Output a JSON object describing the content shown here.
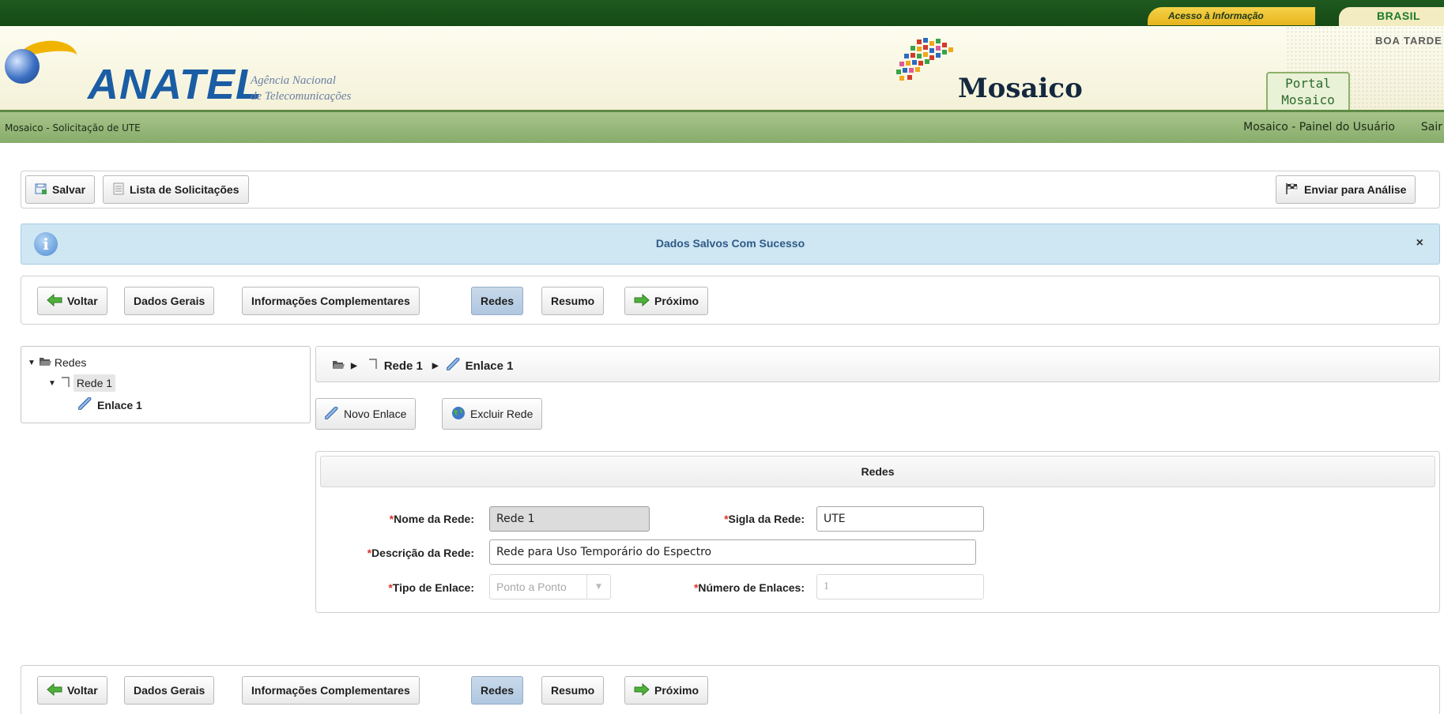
{
  "topbar": {
    "access_label": "Acesso à Informação",
    "country_label": "BRASIL"
  },
  "header": {
    "logo_text": "ANATEL",
    "agency_line1": "Agência Nacional",
    "agency_line2": "de Telecomunicações",
    "product_title": "Mosaico",
    "greeting": "BOA TARDE",
    "portal_tab_line1": "Portal",
    "portal_tab_line2": "Mosaico"
  },
  "nav": {
    "breadcrumb": "Mosaico - Solicitação de UTE",
    "user_panel_link": "Mosaico - Painel do Usuário",
    "exit_link": "Sair"
  },
  "toolbar": {
    "save_label": "Salvar",
    "list_label": "Lista de Solicitações",
    "submit_label": "Enviar para Análise"
  },
  "message": {
    "text": "Dados Salvos Com Sucesso",
    "close": "×"
  },
  "steps": [
    "Voltar",
    "Dados Gerais",
    "Informações Complementares",
    "Redes",
    "Resumo",
    "Próximo"
  ],
  "tree": {
    "root": "Redes",
    "network": "Rede 1",
    "link": "Enlace 1"
  },
  "crumb": {
    "network": "Rede 1",
    "link": "Enlace 1"
  },
  "actions": {
    "new_link": "Novo Enlace",
    "delete_network": "Excluir Rede"
  },
  "form": {
    "title": "Redes",
    "required_mark": "*",
    "network_name_label": "Nome da Rede:",
    "network_name_value": "Rede  1",
    "network_acronym_label": "Sigla da Rede:",
    "network_acronym_value": "UTE",
    "description_label": "Descrição da Rede:",
    "description_value": "Rede para Uso Temporário do Espectro",
    "link_type_label": "Tipo de Enlace:",
    "link_type_value": "Ponto a Ponto",
    "link_count_label": "Número de Enlaces:",
    "link_count_value": "1"
  },
  "colors": {
    "gov_green": "#1f5a1f",
    "nav_green": "#98b87b",
    "info_blue": "#cfe6f3",
    "active_step": "#b9cfe5"
  }
}
